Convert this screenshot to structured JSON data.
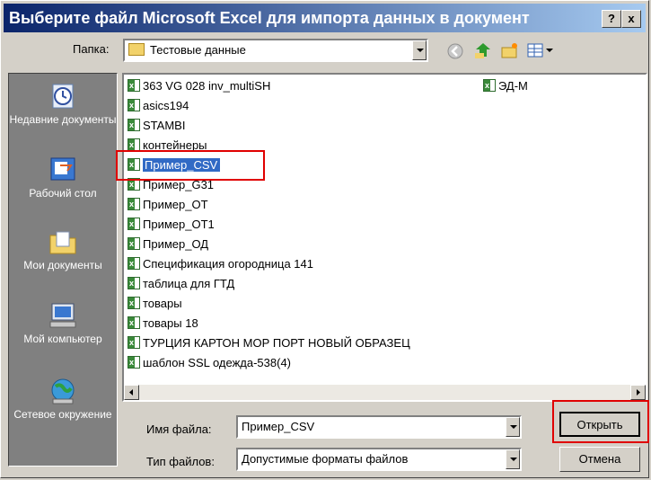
{
  "window": {
    "title": "Выберите файл Microsoft Excel для импорта данных в документ",
    "help_label": "?",
    "close_label": "x"
  },
  "toolbar": {
    "folder_label": "Папка:",
    "folder_value": "Тестовые данные"
  },
  "places": [
    {
      "label": "Недавние документы",
      "icon": "recent-documents-icon"
    },
    {
      "label": "Рабочий стол",
      "icon": "desktop-icon"
    },
    {
      "label": "Мои документы",
      "icon": "my-documents-icon"
    },
    {
      "label": "Мой компьютер",
      "icon": "my-computer-icon"
    },
    {
      "label": "Сетевое окружение",
      "icon": "network-icon"
    }
  ],
  "files": [
    {
      "name": "363 VG 028 inv_multiSH"
    },
    {
      "name": "asics194"
    },
    {
      "name": "STAMBI"
    },
    {
      "name": "контейнеры"
    },
    {
      "name": "Пример_CSV",
      "selected": true
    },
    {
      "name": "Пример_G31"
    },
    {
      "name": "Пример_ОТ"
    },
    {
      "name": "Пример_ОТ1"
    },
    {
      "name": "Пример_ОД"
    },
    {
      "name": "Спецификация огородница 141"
    },
    {
      "name": "таблица для ГТД"
    },
    {
      "name": "товары"
    },
    {
      "name": "товары 18"
    },
    {
      "name": "ТУРЦИЯ КАРТОН МОР ПОРТ  НОВЫЙ ОБРАЗЕЦ"
    },
    {
      "name": "шаблон SSL одежда-538(4)"
    }
  ],
  "files_col2": [
    {
      "name": "ЭД-М"
    }
  ],
  "filename": {
    "label": "Имя файла:",
    "value": "Пример_CSV"
  },
  "filetype": {
    "label": "Тип файлов:",
    "value": "Допустимые форматы файлов"
  },
  "buttons": {
    "open": "Открыть",
    "cancel": "Отмена"
  },
  "colors": {
    "title_gradient_start": "#0a246a",
    "selection": "#316ac5",
    "highlight_box": "#e00000"
  }
}
